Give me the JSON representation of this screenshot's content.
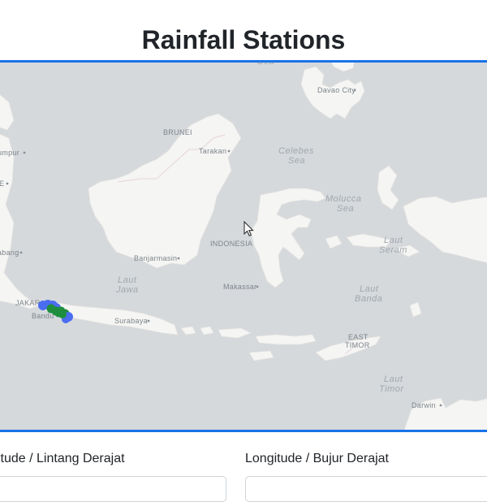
{
  "page": {
    "title": "Rainfall Stations"
  },
  "map": {
    "land_color": "#f5f5f3",
    "water_color": "#d5d9dc",
    "border_color": "#1a73e8",
    "station_colors": [
      "#1a73e8",
      "#4a6df0",
      "#1e8e3e"
    ],
    "place_labels": {
      "davao": "Davao City",
      "brunei": "BRUNEI",
      "tarakan": "Tarakan",
      "lumpur": "umpur",
      "e": "E",
      "abang": "abang",
      "banjarmasin": "Banjarmasin",
      "indonesia": "INDONESIA",
      "makassar": "Makassar",
      "jakarta": "JAKAR",
      "bandung": "Bandu",
      "surabaya": "Surabaya",
      "east_timor_1": "EAST",
      "east_timor_2": "TIMOR",
      "darwin": "Darwin"
    },
    "sea_labels": {
      "sea_top": "Sea",
      "celebes_1": "Celebes",
      "celebes_2": "Sea",
      "molucca_1": "Molucca",
      "molucca_2": "Sea",
      "seram_1": "Laut",
      "seram_2": "Seram",
      "jawa_1": "Laut",
      "jawa_2": "Jawa",
      "banda_1": "Laut",
      "banda_2": "Banda",
      "timor_1": "Laut",
      "timor_2": "Timor"
    }
  },
  "form": {
    "latitude_label": "itude / Lintang Derajat",
    "longitude_label": "Longitude / Bujur Derajat"
  }
}
